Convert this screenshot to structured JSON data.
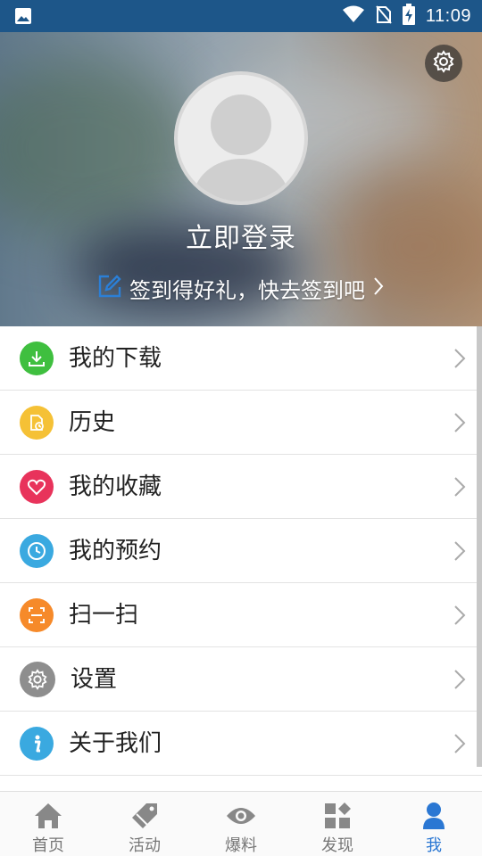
{
  "status_bar": {
    "time": "11:09",
    "left_icon": "image-icon",
    "right_icons": [
      "wifi-icon",
      "no-sim-icon",
      "battery-charging-icon"
    ]
  },
  "profile": {
    "login_label": "立即登录",
    "signin_prompt": "签到得好礼，快去签到吧",
    "settings_icon": "gear-icon"
  },
  "menu": {
    "items": [
      {
        "label": "我的下载",
        "icon": "download-icon",
        "color": "#3fbf3f"
      },
      {
        "label": "历史",
        "icon": "history-icon",
        "color": "#f5c136"
      },
      {
        "label": "我的收藏",
        "icon": "heart-icon",
        "color": "#e8335b"
      },
      {
        "label": "我的预约",
        "icon": "clock-icon",
        "color": "#3aa9e0"
      },
      {
        "label": "扫一扫",
        "icon": "scan-icon",
        "color": "#f68a2a"
      },
      {
        "label": "设置",
        "icon": "gear-icon",
        "color": "#8e8e8e"
      },
      {
        "label": "关于我们",
        "icon": "info-icon",
        "color": "#3aa9e0"
      }
    ]
  },
  "tabbar": {
    "active_color": "#2a77d3",
    "tabs": [
      {
        "label": "首页",
        "icon": "home-icon"
      },
      {
        "label": "活动",
        "icon": "tag-icon"
      },
      {
        "label": "爆料",
        "icon": "eye-icon"
      },
      {
        "label": "发现",
        "icon": "grid-icon"
      },
      {
        "label": "我",
        "icon": "user-icon",
        "active": true
      }
    ]
  }
}
